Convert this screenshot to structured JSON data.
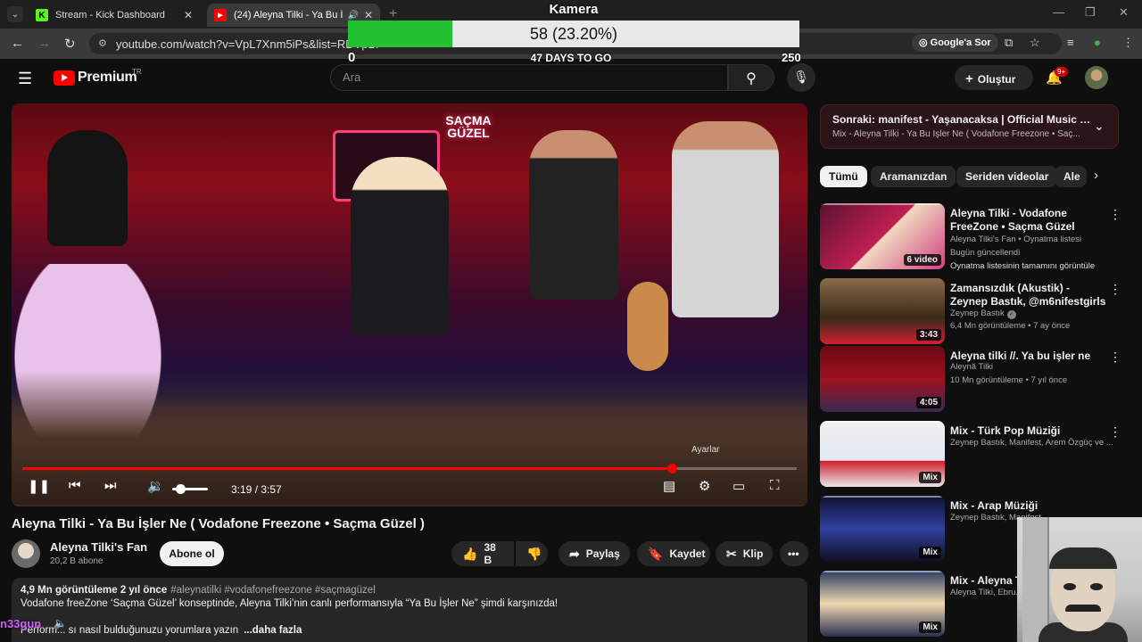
{
  "browser": {
    "tabs": [
      {
        "title": "Stream - Kick Dashboard",
        "favicon": "K"
      },
      {
        "title": "(24) Aleyna Tilki - Ya Bu İşler Ne",
        "favicon": "▶"
      }
    ],
    "url": "youtube.com/watch?v=VpL7Xnm5iPs&list=RDVpL7",
    "google_sor": "Google'a Sor"
  },
  "overlay": {
    "kamera": "Kamera",
    "goal_text": "58 (23.20%)",
    "goal_progress": 0.232,
    "goal_min": "0",
    "goal_max": "250",
    "days_to_go": "47 DAYS TO GO",
    "fill_color": "#22c232"
  },
  "youtube": {
    "brand": "Premium",
    "brand_tr": "TR",
    "search_placeholder": "Ara",
    "create_label": "Oluştur",
    "notif_badge": "9+"
  },
  "video": {
    "sign": "SAÇMA GÜZEL",
    "tooltip": "Ayarlar",
    "time": "3:19 / 3:57",
    "progress": 0.839,
    "title": "Aleyna Tilki - Ya Bu İşler Ne ( Vodafone Freezone • Saçma Güzel )",
    "channel": "Aleyna Tilki's Fan",
    "subscribers": "20,2 B abone",
    "subscribe_label": "Abone ol",
    "likes": "38 B",
    "share_label": "Paylaş",
    "save_label": "Kaydet",
    "clip_label": "Klip",
    "desc_meta": "4,9 Mn görüntüleme  2 yıl önce",
    "desc_tags": "#aleynatilki #vodafonefreezone #saçmagüzel",
    "desc_line2": "Vodafone freeZone ‘Saçma Güzel’ konseptinde, Aleyna Tilki’nin canlı performansıyla “Ya Bu İşler Ne” şimdi karşınızda!",
    "desc_line3": "Perform... sı nasıl bulduğunuzu yorumlara yazın",
    "desc_more": "...daha fazla"
  },
  "chat": {
    "username": "n33gun"
  },
  "sidebar": {
    "next_title": "Sonraki: manifest - Yaşanacaksa | Official Music Vi...",
    "next_sub": "Mix - Aleyna Tilki - Ya Bu İşler Ne ( Vodafone Freezone • Saç...",
    "chips": [
      "Tümü",
      "Aramanızdan",
      "Seriden videolar",
      "Ale"
    ],
    "recs": [
      {
        "title": "Aleyna Tilki - Vodafone FreeZone • Saçma Güzel",
        "meta1": "Aleyna Tilki's Fan • Oynatma listesi",
        "meta2": "Bugün güncellendi",
        "meta3": "Oynatma listesinin tamamını görüntüle",
        "badge": "6 video"
      },
      {
        "title": "Zamansızdık (Akustik) - Zeynep Bastık, @m6nifestgirls",
        "meta1": "Zeynep Bastık",
        "meta2": "6,4 Mn görüntüleme • 7 ay önce",
        "badge": "3:43"
      },
      {
        "title": "Aleyna tilki //. Ya bu işler ne",
        "meta1": "Aleynă Tilki",
        "meta2": "10 Mn görüntüleme • 7 yıl önce",
        "badge": "4:05"
      },
      {
        "title": "Mix - Türk Pop Müziği",
        "meta1": "Zeynep Bastık, Manifest, Arem Özgüç ve ...",
        "badge": "Mix"
      },
      {
        "title": "Mix - Arap Müziği",
        "meta1": "Zeynep Bastık, Manifest, ...",
        "badge": "Mix"
      },
      {
        "title": "Mix - Aleyna Tilki",
        "meta1": "Aleyna Tilki, Ebru...",
        "badge": "Mix"
      }
    ]
  }
}
